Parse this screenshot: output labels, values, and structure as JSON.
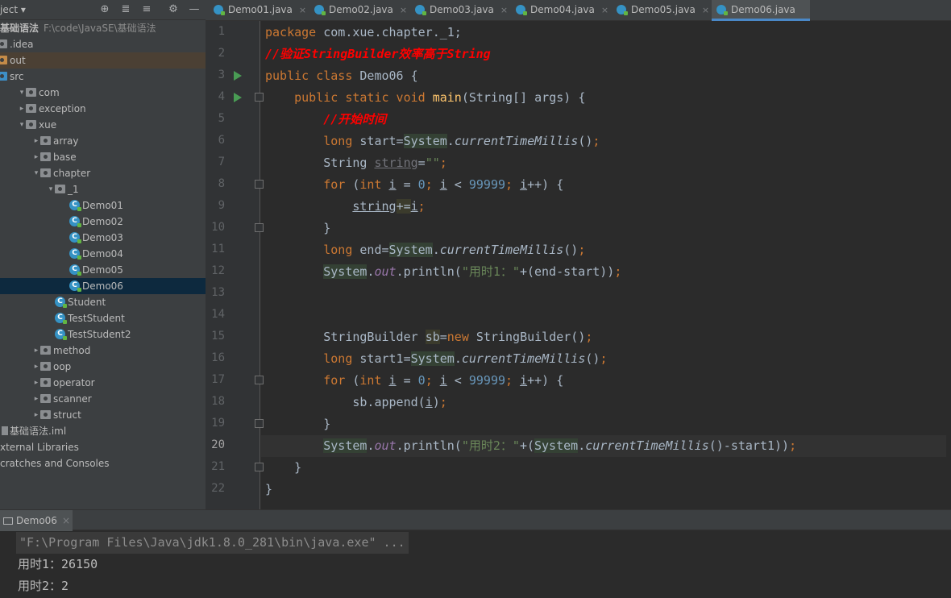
{
  "project": {
    "title": "ject",
    "tree": [
      {
        "label": "基础语法",
        "path": "F:\\code\\JavaSE\\基础语法",
        "kind": "module"
      },
      {
        "label": ".idea",
        "kind": "folder"
      },
      {
        "label": "out",
        "kind": "folder-out"
      },
      {
        "label": "src",
        "kind": "folder-src"
      },
      {
        "label": "com",
        "kind": "folder"
      },
      {
        "label": "exception",
        "kind": "folder"
      },
      {
        "label": "xue",
        "kind": "folder"
      },
      {
        "label": "array",
        "kind": "folder"
      },
      {
        "label": "base",
        "kind": "folder"
      },
      {
        "label": "chapter",
        "kind": "folder"
      },
      {
        "label": "_1",
        "kind": "folder"
      },
      {
        "label": "Demo01",
        "kind": "class"
      },
      {
        "label": "Demo02",
        "kind": "class"
      },
      {
        "label": "Demo03",
        "kind": "class"
      },
      {
        "label": "Demo04",
        "kind": "class"
      },
      {
        "label": "Demo05",
        "kind": "class"
      },
      {
        "label": "Demo06",
        "kind": "class"
      },
      {
        "label": "Student",
        "kind": "class"
      },
      {
        "label": "TestStudent",
        "kind": "class"
      },
      {
        "label": "TestStudent2",
        "kind": "class"
      },
      {
        "label": "method",
        "kind": "folder"
      },
      {
        "label": "oop",
        "kind": "folder"
      },
      {
        "label": "operator",
        "kind": "folder"
      },
      {
        "label": "scanner",
        "kind": "folder"
      },
      {
        "label": "struct",
        "kind": "folder"
      },
      {
        "label": "基础语法.iml",
        "kind": "iml"
      },
      {
        "label": "xternal Libraries",
        "kind": "none"
      },
      {
        "label": "cratches and Consoles",
        "kind": "none"
      }
    ]
  },
  "tabs": [
    "Demo01.java",
    "Demo02.java",
    "Demo03.java",
    "Demo04.java",
    "Demo05.java",
    "Demo06.java"
  ],
  "tab_close": "×",
  "editor": {
    "line_numbers": [
      "1",
      "2",
      "3",
      "4",
      "5",
      "6",
      "7",
      "8",
      "9",
      "10",
      "11",
      "12",
      "13",
      "14",
      "15",
      "16",
      "17",
      "18",
      "19",
      "20",
      "21",
      "22"
    ],
    "code": {
      "l1_kw": "package",
      "l1_rest": " com.xue.chapter._1;",
      "l2": "//验证StringBuilder效率高于String",
      "l3_kw": "public class",
      "l3_rest": " Demo06 {",
      "l4_kw": "public static void",
      "l4_fn": "main",
      "l4_rest": "(String[] args) {",
      "l5": "//开始时间",
      "l6_kw": "long",
      "l6_a": " start=",
      "l6_sys": "System",
      "l6_dot": ".",
      "l6_m": "currentTimeMillis",
      "l6_end": "()",
      "l6_semi": ";",
      "l7_type": "String ",
      "l7_var": "string",
      "l7_eq": "=",
      "l7_str": "\"\"",
      "l7_semi": ";",
      "l8_kw": "for",
      "l8_a": " (",
      "l8_int": "int",
      "l8_i": "i",
      "l8_b": " = ",
      "l8_zero": "0",
      "l8_semi1": "; ",
      "l8_i2": "i",
      "l8_c": " < ",
      "l8_num": "99999",
      "l8_semi2": "; ",
      "l8_i3": "i",
      "l8_d": "++) {",
      "l9_var": "string",
      "l9_op": "+=",
      "l9_i": "i",
      "l9_semi": ";",
      "l10": "}",
      "l11_kw": "long",
      "l11_a": " end=",
      "l11_sys": "System",
      "l11_dot": ".",
      "l11_m": "currentTimeMillis",
      "l11_end": "()",
      "l11_semi": ";",
      "l12_sys": "System",
      "l12_dot": ".",
      "l12_out": "out",
      "l12_a": ".println(",
      "l12_str": "\"用时1：\"",
      "l12_b": "+(end-start))",
      "l12_semi": ";",
      "l15_a": "StringBuilder ",
      "l15_var": "sb",
      "l15_eq": "=",
      "l15_new": "new",
      "l15_b": " StringBuilder()",
      "l15_semi": ";",
      "l16_kw": "long",
      "l16_a": " start1=",
      "l16_sys": "System",
      "l16_dot": ".",
      "l16_m": "currentTimeMillis",
      "l16_end": "()",
      "l16_semi": ";",
      "l17_kw": "for",
      "l17_a": " (",
      "l17_int": "int",
      "l17_i": "i",
      "l17_b": " = ",
      "l17_zero": "0",
      "l17_semi1": "; ",
      "l17_i2": "i",
      "l17_c": " < ",
      "l17_num": "99999",
      "l17_semi2": "; ",
      "l17_i3": "i",
      "l17_d": "++) {",
      "l18_a": "sb.append(",
      "l18_i": "i",
      "l18_b": ")",
      "l18_semi": ";",
      "l19": "}",
      "l20_sys": "System",
      "l20_dot": ".",
      "l20_out": "out",
      "l20_a": ".println(",
      "l20_str": "\"用时2：\"",
      "l20_b": "+(",
      "l20_sys2": "System",
      "l20_dot2": ".",
      "l20_m": "currentTimeMillis",
      "l20_c": "()-start1))",
      "l20_semi": ";",
      "l21": "}",
      "l22": "}"
    }
  },
  "run": {
    "tab_label": "Demo06",
    "close": "×",
    "lines": [
      "\"F:\\Program Files\\Java\\jdk1.8.0_281\\bin\\java.exe\" ...",
      "用时1：26150",
      "用时2：2"
    ]
  }
}
